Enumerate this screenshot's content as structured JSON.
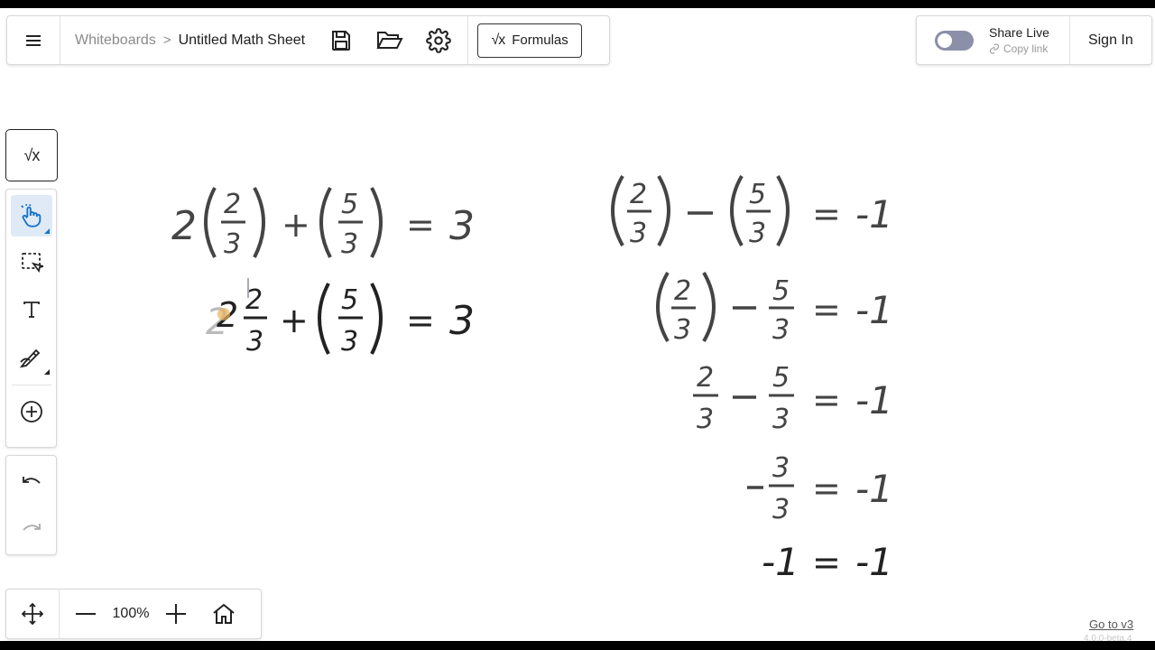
{
  "header": {
    "breadcrumb_root": "Whiteboards",
    "breadcrumb_separator": ">",
    "title": "Untitled Math Sheet",
    "formulas_label": "Formulas"
  },
  "share": {
    "title": "Share Live",
    "copy_link": "Copy link",
    "enabled": false
  },
  "auth": {
    "sign_in": "Sign In"
  },
  "toolbar": {
    "tools": [
      {
        "name": "formula-icon",
        "active": false
      },
      {
        "name": "hand-pointer-icon",
        "active": true
      },
      {
        "name": "lasso-select-icon",
        "active": false
      },
      {
        "name": "text-icon",
        "active": false
      },
      {
        "name": "pen-icon",
        "active": false
      },
      {
        "name": "add-circle-icon",
        "active": false
      },
      {
        "name": "undo-icon",
        "active": false
      },
      {
        "name": "redo-icon",
        "active": false
      }
    ]
  },
  "zoom": {
    "level": "100%"
  },
  "footer": {
    "goto_v3": "Go to v3",
    "version": "4.0.0-beta.4"
  },
  "canvas": {
    "left_equation_1": {
      "lead": "2",
      "plus": "+",
      "equals": "=",
      "rhs": "3"
    },
    "left_equation_2": {
      "lead": "2",
      "plus": "+",
      "equals": "=",
      "rhs": "3"
    },
    "right_steps_rhs": "-1",
    "colors": {
      "ink": "#444444",
      "accent": "#1a73c7"
    }
  }
}
